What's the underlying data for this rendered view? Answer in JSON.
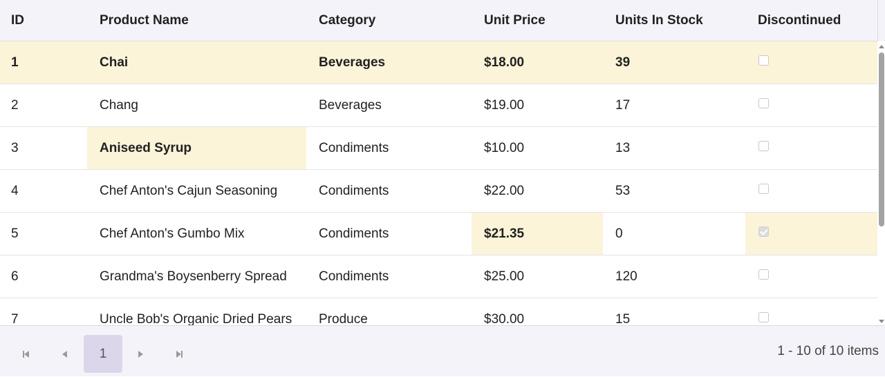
{
  "columns": [
    "ID",
    "Product Name",
    "Category",
    "Unit Price",
    "Units In Stock",
    "Discontinued"
  ],
  "rows": [
    {
      "id": "1",
      "name": "Chai",
      "category": "Beverages",
      "price": "$18.00",
      "stock": "39",
      "discontinued": false
    },
    {
      "id": "2",
      "name": "Chang",
      "category": "Beverages",
      "price": "$19.00",
      "stock": "17",
      "discontinued": false
    },
    {
      "id": "3",
      "name": "Aniseed Syrup",
      "category": "Condiments",
      "price": "$10.00",
      "stock": "13",
      "discontinued": false
    },
    {
      "id": "4",
      "name": "Chef Anton's Cajun Seasoning",
      "category": "Condiments",
      "price": "$22.00",
      "stock": "53",
      "discontinued": false
    },
    {
      "id": "5",
      "name": "Chef Anton's Gumbo Mix",
      "category": "Condiments",
      "price": "$21.35",
      "stock": "0",
      "discontinued": true
    },
    {
      "id": "6",
      "name": "Grandma's Boysenberry Spread",
      "category": "Condiments",
      "price": "$25.00",
      "stock": "120",
      "discontinued": false
    },
    {
      "id": "7",
      "name": "Uncle Bob's Organic Dried Pears",
      "category": "Produce",
      "price": "$30.00",
      "stock": "15",
      "discontinued": false
    }
  ],
  "pager": {
    "current_page": "1",
    "info": "1 - 10 of 10 items"
  },
  "colors": {
    "header_bg": "#f5f3fa",
    "highlight_bg": "#fbf4d9",
    "page_button_bg": "#dcd6ea"
  }
}
